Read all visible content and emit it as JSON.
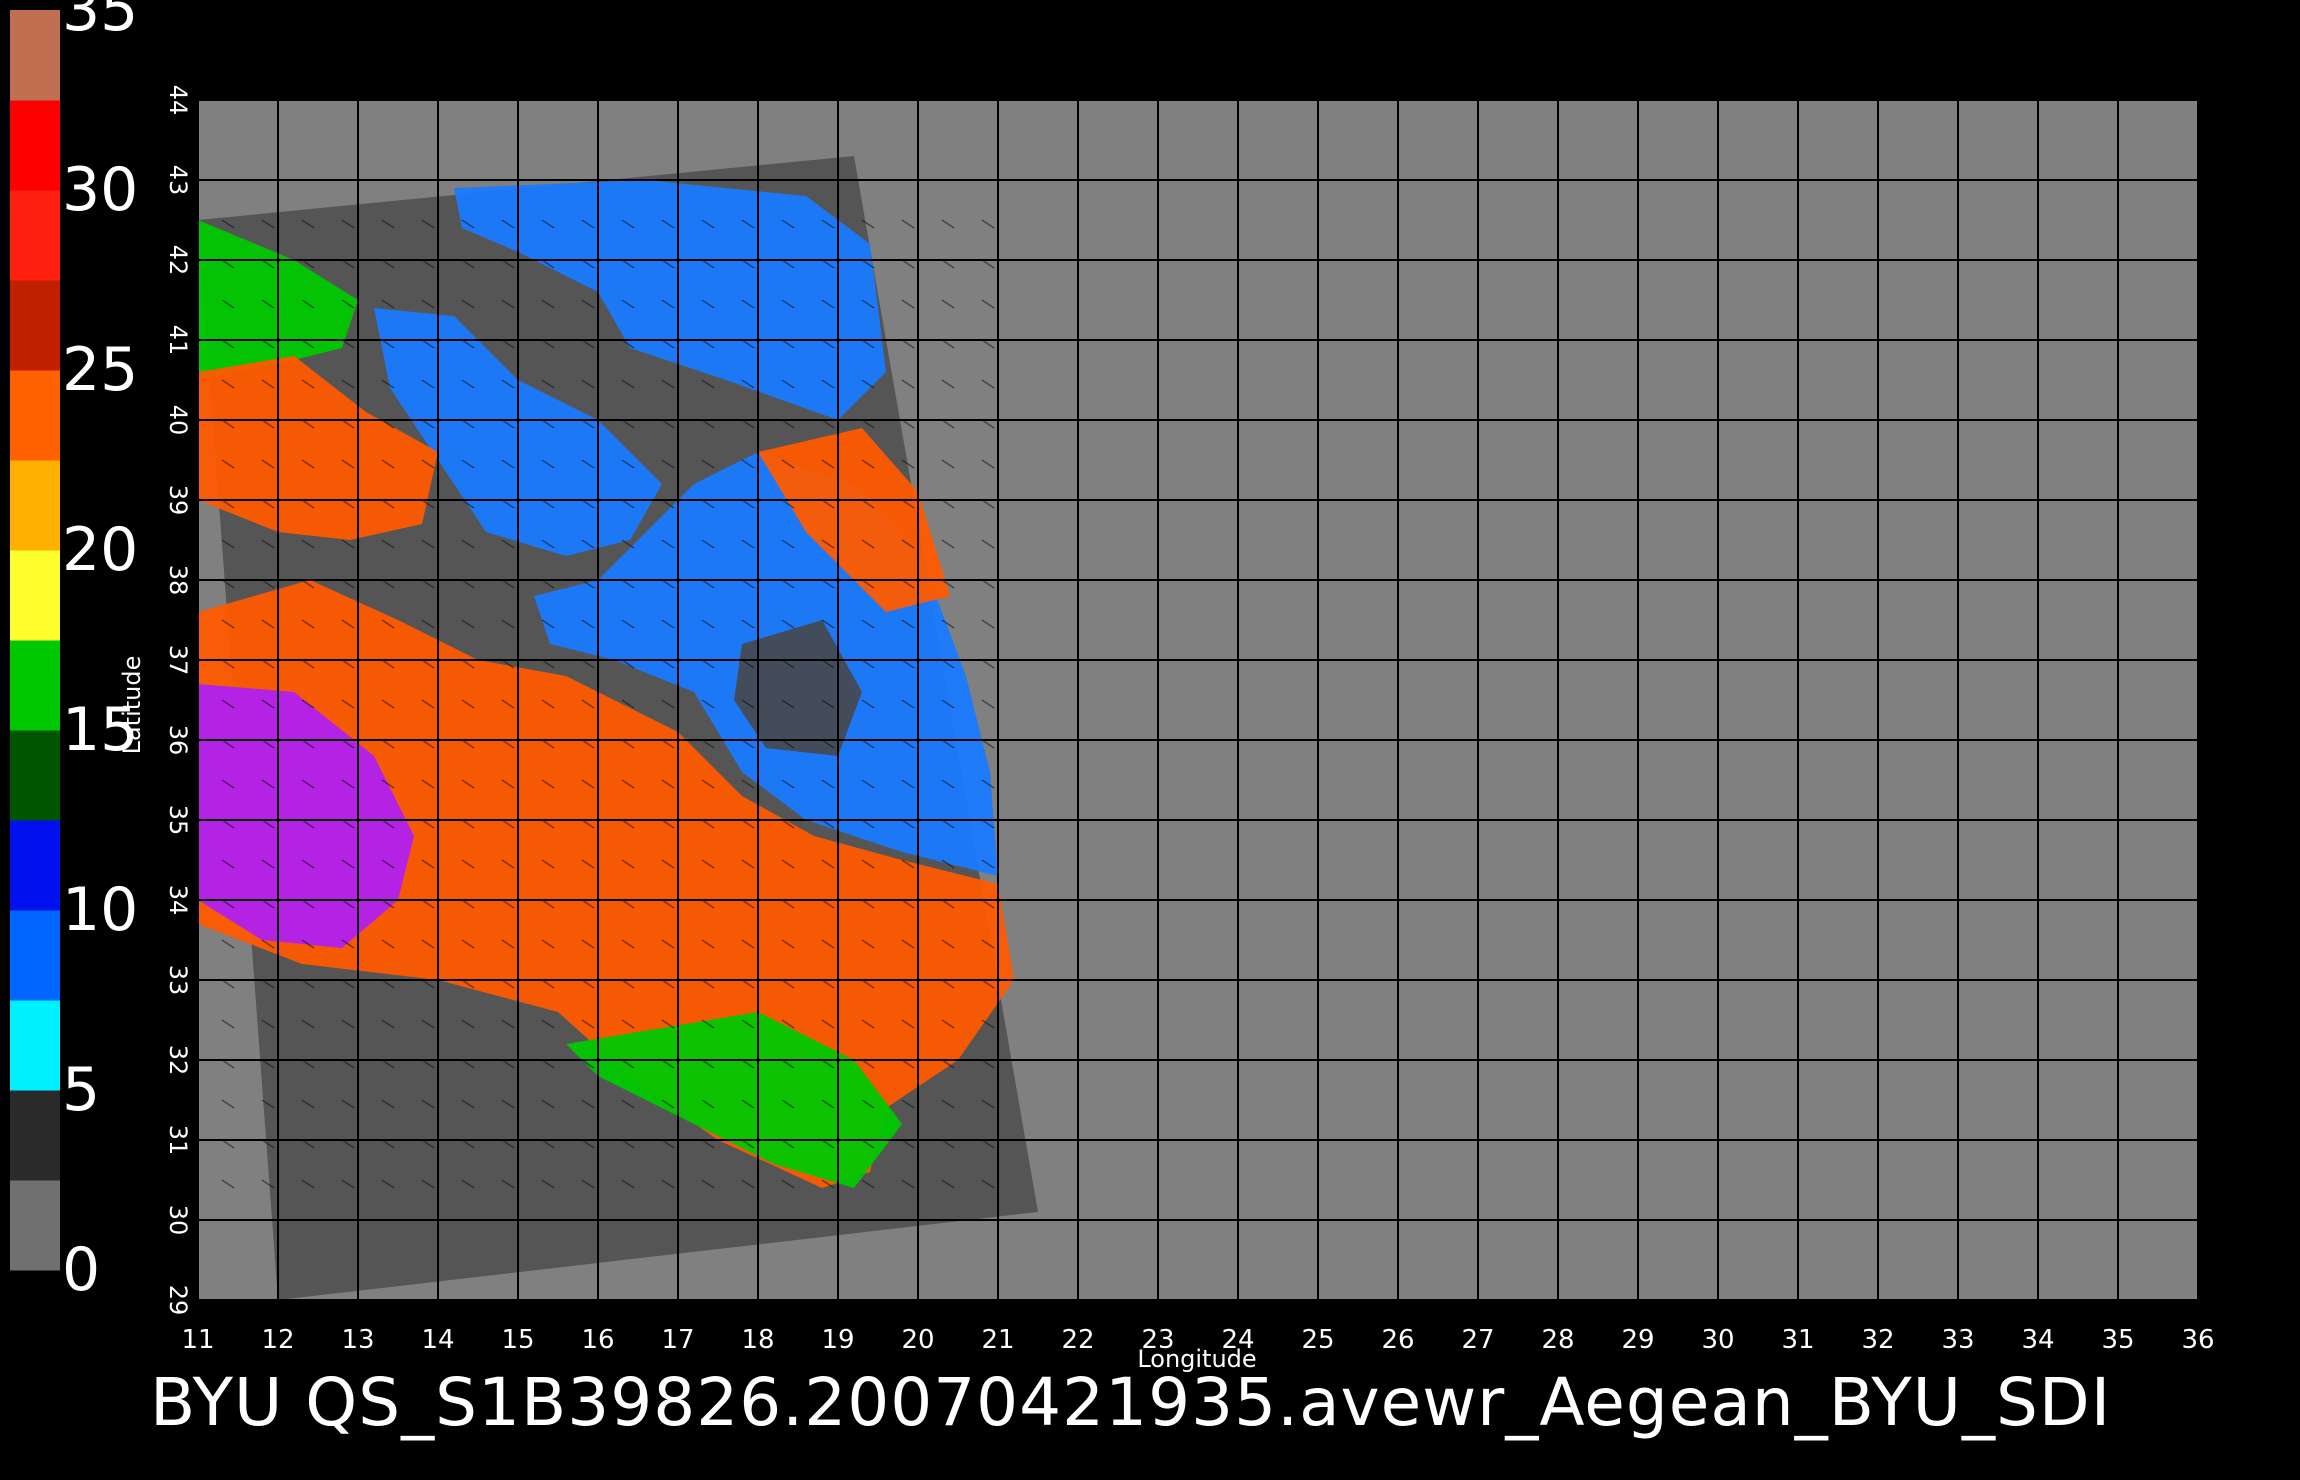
{
  "figure": {
    "footer_text": "BYU  QS_S1B39826.20070421935.avewr_Aegean_BYU_SDI",
    "x_axis_label": "Longitude",
    "y_axis_label": "Latitude"
  },
  "colorbar": {
    "labels": [
      "0",
      "5",
      "10",
      "15",
      "20",
      "25",
      "30",
      "35"
    ],
    "segments": [
      "#707070",
      "#2a2a2a",
      "#00f0ff",
      "#0066ff",
      "#0010ee",
      "#005500",
      "#00c800",
      "#ffff30",
      "#ffb000",
      "#ff6000",
      "#c02000",
      "#ff2010",
      "#ff0000",
      "#c07050"
    ]
  },
  "chart_data": {
    "type": "map",
    "x_ticks": [
      11,
      12,
      13,
      14,
      15,
      16,
      17,
      18,
      19,
      20,
      21,
      22,
      23,
      24,
      25,
      26,
      27,
      28,
      29,
      30,
      31,
      32,
      33,
      34,
      35,
      36
    ],
    "y_ticks": [
      29,
      30,
      31,
      32,
      33,
      34,
      35,
      36,
      37,
      38,
      39,
      40,
      41,
      42,
      43,
      44
    ],
    "xlim": [
      11,
      36
    ],
    "ylim": [
      29,
      44
    ],
    "colorbar_range": [
      0,
      35
    ],
    "grid": true,
    "swath_corners_lonlat": [
      [
        11.0,
        42.5
      ],
      [
        19.2,
        43.3
      ],
      [
        21.5,
        30.1
      ],
      [
        12.0,
        29.0
      ]
    ],
    "colors": {
      "background_no_data": "#808080",
      "land": "#555555",
      "low_wind": "#1a7aff",
      "moderate_wind": "#00c800",
      "high_wind": "#ff5a00",
      "very_high_wind": "#b020f0"
    }
  }
}
